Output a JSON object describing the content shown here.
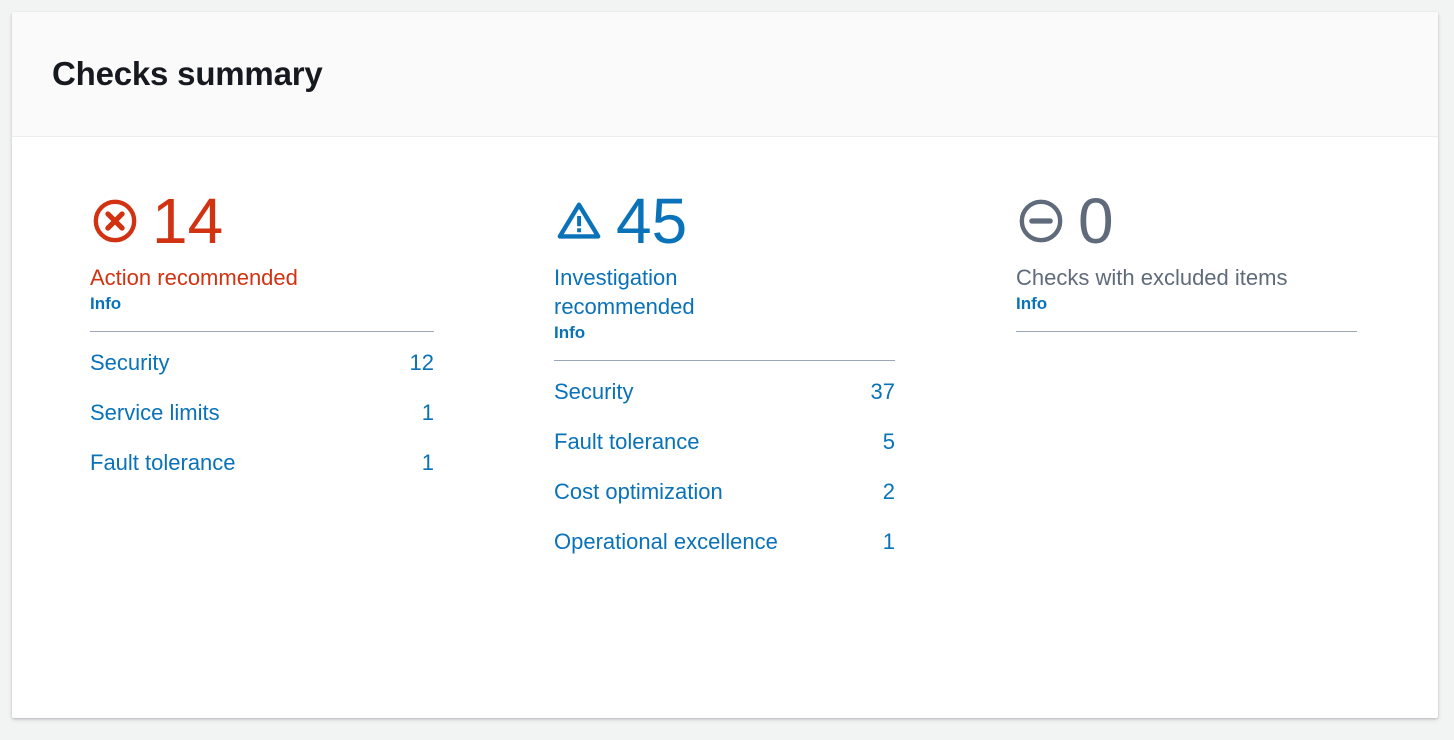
{
  "card": {
    "title": "Checks summary"
  },
  "colors": {
    "error": "#d13212",
    "link": "#0972b8",
    "muted": "#5f6b7a",
    "divider": "#9ba7b6",
    "header_bg": "#fafafa",
    "page_bg": "#f2f3f3"
  },
  "columns": [
    {
      "icon": "status-error-icon",
      "count": "14",
      "label": "Action recommended",
      "info_label": "Info",
      "tone": "error",
      "items": [
        {
          "name": "Security",
          "count": "12"
        },
        {
          "name": "Service limits",
          "count": "1"
        },
        {
          "name": "Fault tolerance",
          "count": "1"
        }
      ]
    },
    {
      "icon": "status-warning-icon",
      "count": "45",
      "label": "Investigation recommended",
      "info_label": "Info",
      "tone": "info",
      "items": [
        {
          "name": "Security",
          "count": "37"
        },
        {
          "name": "Fault tolerance",
          "count": "5"
        },
        {
          "name": "Cost optimization",
          "count": "2"
        },
        {
          "name": "Operational excellence",
          "count": "1"
        }
      ]
    },
    {
      "icon": "status-excluded-icon",
      "count": "0",
      "label": "Checks with excluded items",
      "info_label": "Info",
      "tone": "muted",
      "items": []
    }
  ]
}
